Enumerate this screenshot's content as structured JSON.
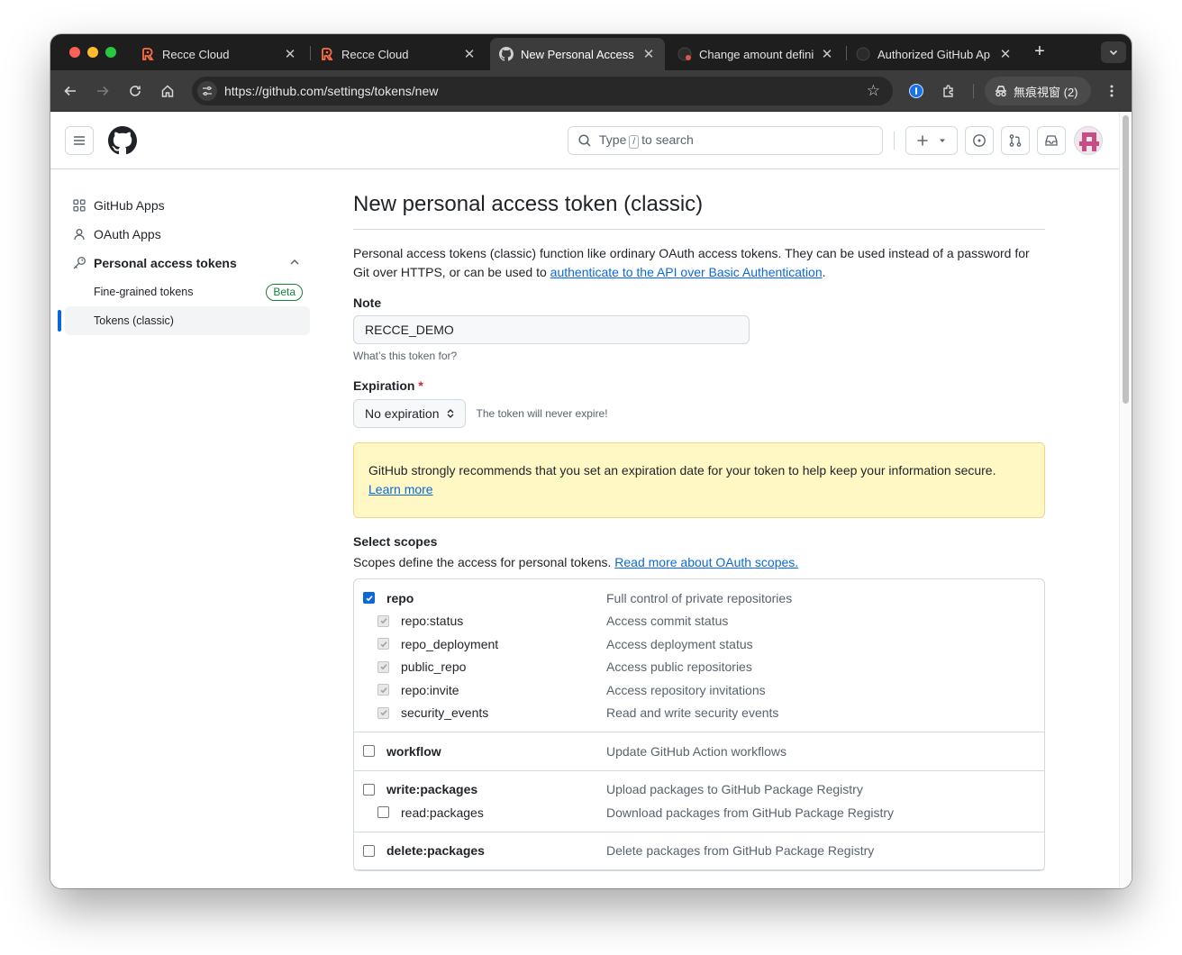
{
  "browser": {
    "tabs": [
      {
        "title": "Recce Cloud",
        "icon": "recce-icon",
        "active": false
      },
      {
        "title": "Recce Cloud",
        "icon": "recce-icon",
        "active": false
      },
      {
        "title": "New Personal Access",
        "icon": "github-icon",
        "active": true
      },
      {
        "title": "Change amount defini",
        "icon": "github-icon",
        "active": false
      },
      {
        "title": "Authorized GitHub Ap",
        "icon": "github-icon",
        "active": false
      }
    ],
    "url": "https://github.com/settings/tokens/new",
    "profile_label": "無痕視窗 (2)"
  },
  "header": {
    "search_prefix": "Type",
    "search_key": "/",
    "search_suffix": "to search"
  },
  "sidebar": {
    "items": [
      {
        "label": "GitHub Apps",
        "icon": "apps-grid-icon"
      },
      {
        "label": "OAuth Apps",
        "icon": "person-icon"
      },
      {
        "label": "Personal access tokens",
        "icon": "key-icon"
      }
    ],
    "sub_items": [
      {
        "label": "Fine-grained tokens",
        "badge": "Beta"
      },
      {
        "label": "Tokens (classic)",
        "selected": true
      }
    ]
  },
  "main": {
    "title": "New personal access token (classic)",
    "intro_text": "Personal access tokens (classic) function like ordinary OAuth access tokens. They can be used instead of a password for Git over HTTPS, or can be used to ",
    "intro_link": "authenticate to the API over Basic Authentication",
    "intro_end": ".",
    "note_label": "Note",
    "note_value": "RECCE_DEMO",
    "note_hint": "What’s this token for?",
    "expiration_label": "Expiration",
    "expiration_required": "*",
    "expiration_value": "No expiration",
    "expiration_hint": "The token will never expire!",
    "warning_text": "GitHub strongly recommends that you set an expiration date for your token to help keep your information secure. ",
    "warning_link": "Learn more",
    "scopes_label": "Select scopes",
    "scopes_text": "Scopes define the access for personal tokens. ",
    "scopes_link": "Read more about OAuth scopes.",
    "scopes": [
      {
        "name": "repo",
        "desc": "Full control of private repositories",
        "checked": true,
        "children": [
          {
            "name": "repo:status",
            "desc": "Access commit status"
          },
          {
            "name": "repo_deployment",
            "desc": "Access deployment status"
          },
          {
            "name": "public_repo",
            "desc": "Access public repositories"
          },
          {
            "name": "repo:invite",
            "desc": "Access repository invitations"
          },
          {
            "name": "security_events",
            "desc": "Read and write security events"
          }
        ]
      },
      {
        "name": "workflow",
        "desc": "Update GitHub Action workflows",
        "checked": false,
        "children": []
      },
      {
        "name": "write:packages",
        "desc": "Upload packages to GitHub Package Registry",
        "checked": false,
        "children": [
          {
            "name": "read:packages",
            "desc": "Download packages from GitHub Package Registry"
          }
        ]
      },
      {
        "name": "delete:packages",
        "desc": "Delete packages from GitHub Package Registry",
        "checked": false,
        "children": []
      }
    ]
  },
  "colors": {
    "accent": "#0969da",
    "warning_bg": "#fff8c5",
    "success": "#1a7f37"
  }
}
